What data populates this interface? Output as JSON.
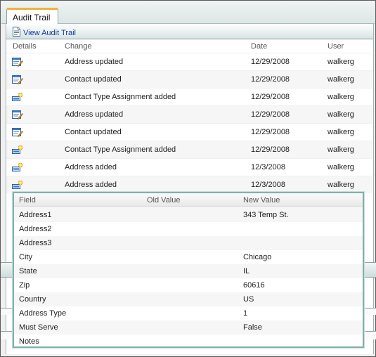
{
  "tab": {
    "label": "Audit Trail"
  },
  "toolbar": {
    "view_label": "View Audit Trail",
    "icon": "document-icon"
  },
  "table": {
    "columns": {
      "details": "Details",
      "change": "Change",
      "date": "Date",
      "user": "User"
    },
    "rows": [
      {
        "icon": "edit-record-icon",
        "change": "Address updated",
        "date": "12/29/2008",
        "user": "walkerg"
      },
      {
        "icon": "edit-record-icon",
        "change": "Contact updated",
        "date": "12/29/2008",
        "user": "walkerg"
      },
      {
        "icon": "add-record-icon",
        "change": "Contact Type Assignment added",
        "date": "12/29/2008",
        "user": "walkerg"
      },
      {
        "icon": "edit-record-icon",
        "change": "Address updated",
        "date": "12/29/2008",
        "user": "walkerg"
      },
      {
        "icon": "edit-record-icon",
        "change": "Contact updated",
        "date": "12/29/2008",
        "user": "walkerg"
      },
      {
        "icon": "add-record-icon",
        "change": "Contact Type Assignment added",
        "date": "12/29/2008",
        "user": "walkerg"
      },
      {
        "icon": "add-record-icon",
        "change": "Address added",
        "date": "12/3/2008",
        "user": "walkerg"
      },
      {
        "icon": "add-record-icon",
        "change": "Address added",
        "date": "12/3/2008",
        "user": "walkerg"
      }
    ]
  },
  "popup": {
    "columns": {
      "field": "Field",
      "old": "Old Value",
      "new": "New Value"
    },
    "rows": [
      {
        "field": "Address1",
        "old": "",
        "new": "343 Temp St."
      },
      {
        "field": "Address2",
        "old": "",
        "new": ""
      },
      {
        "field": "Address3",
        "old": "",
        "new": ""
      },
      {
        "field": "City",
        "old": "",
        "new": "Chicago"
      },
      {
        "field": "State",
        "old": "",
        "new": "IL"
      },
      {
        "field": "Zip",
        "old": "",
        "new": "60616"
      },
      {
        "field": "Country",
        "old": "",
        "new": "US"
      },
      {
        "field": "Address Type",
        "old": "",
        "new": "1"
      },
      {
        "field": "Must Serve",
        "old": "",
        "new": "False"
      },
      {
        "field": "Notes",
        "old": "",
        "new": ""
      }
    ]
  },
  "colors": {
    "accent": "#7fb0ac",
    "tab_highlight": "#f2b23a",
    "link": "#123a9c"
  }
}
